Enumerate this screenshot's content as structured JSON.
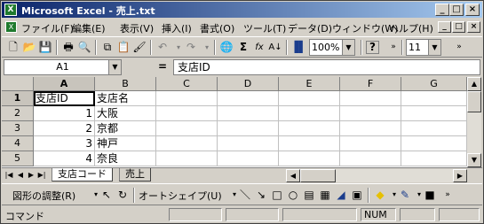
{
  "window": {
    "title": "Microsoft Excel - 売上.txt",
    "app_icon": "X",
    "minimize": "_",
    "maximize": "□",
    "close": "×"
  },
  "menu": {
    "items": [
      "ファイル(F)",
      "編集(E)",
      "表示(V)",
      "挿入(I)",
      "書式(O)",
      "ツール(T)",
      "データ(D)",
      "ウィンドウ(W)",
      "ヘルプ(H)"
    ],
    "doc_icon": "X"
  },
  "toolbar": {
    "zoom": "100%",
    "font_size": "11",
    "sigma": "Σ",
    "fx": "fx",
    "help": "?"
  },
  "formula_bar": {
    "name_box": "A1",
    "equals": "=",
    "content": "支店ID"
  },
  "columns": [
    "A",
    "B",
    "C",
    "D",
    "E",
    "F",
    "G"
  ],
  "rows": [
    {
      "num": "1",
      "a": "支店ID",
      "b": "支店名"
    },
    {
      "num": "2",
      "a": "1",
      "b": "大阪"
    },
    {
      "num": "3",
      "a": "2",
      "b": "京都"
    },
    {
      "num": "4",
      "a": "3",
      "b": "神戸"
    },
    {
      "num": "5",
      "a": "4",
      "b": "奈良"
    }
  ],
  "sheets": [
    "支店コード",
    "売上"
  ],
  "drawing": {
    "adjust": "図形の調整(R)",
    "autoshape": "オートシェイプ(U)"
  },
  "status": {
    "mode": "コマンド",
    "num": "NUM"
  },
  "colors": {
    "title_start": "#0a246a",
    "title_end": "#a6caf0",
    "face": "#d4d0c8"
  }
}
